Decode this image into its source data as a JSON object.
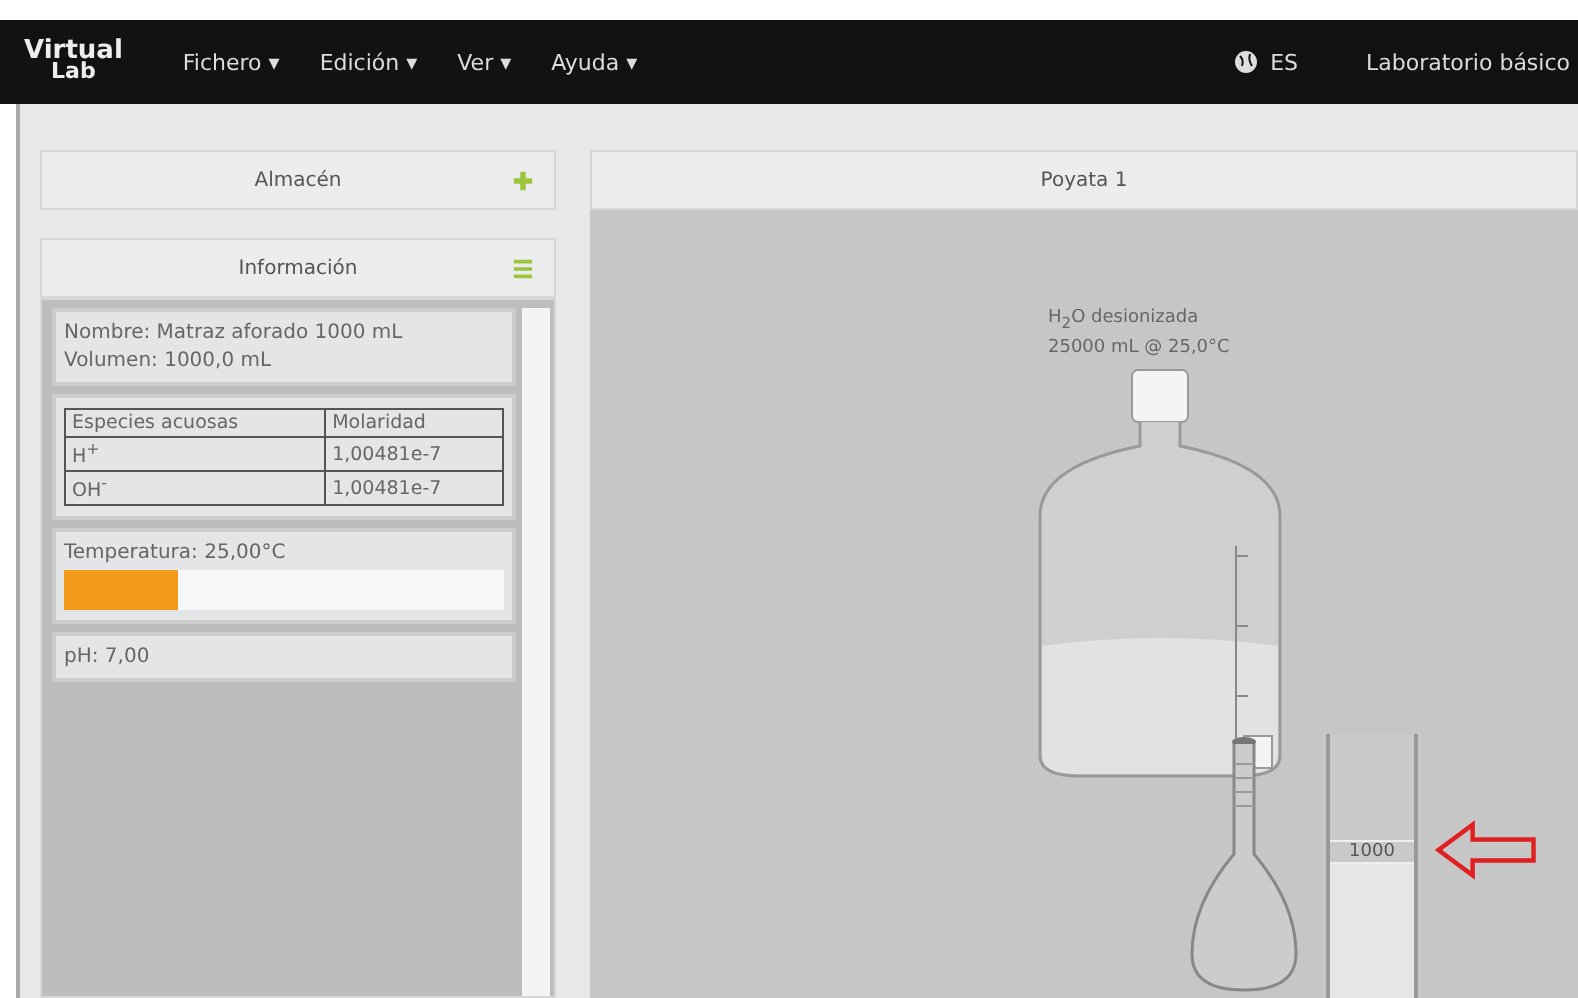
{
  "navbar": {
    "logo_top": "Virtual",
    "logo_bottom": "Lab",
    "menus": [
      "Fichero ▾",
      "Edición ▾",
      "Ver ▾",
      "Ayuda ▾"
    ],
    "language": "ES",
    "lab": "Laboratorio básico"
  },
  "storage_panel": {
    "title": "Almacén"
  },
  "info_panel": {
    "title": "Información",
    "name_line": "Nombre: Matraz aforado 1000 mL",
    "volume_line": "Volumen: 1000,0 mL",
    "table": {
      "columns": [
        "Especies acuosas",
        "Molaridad"
      ],
      "rows": [
        {
          "species": "H$^{+}$",
          "molarity": "1,00481e-7"
        },
        {
          "species": "OH$^{-}$",
          "molarity": "1,00481e-7"
        }
      ]
    },
    "temperature": "Temperatura: 25,00°C",
    "temperature_bar": {
      "level": 0.26
    },
    "ph": "pH: 7,00"
  },
  "bench": {
    "title": "Poyata 1",
    "bottle_label": "H$_{2}$O desionizada",
    "bottle_volume": "25000 mL @ 25,0°C",
    "flask_reading": "1000"
  }
}
